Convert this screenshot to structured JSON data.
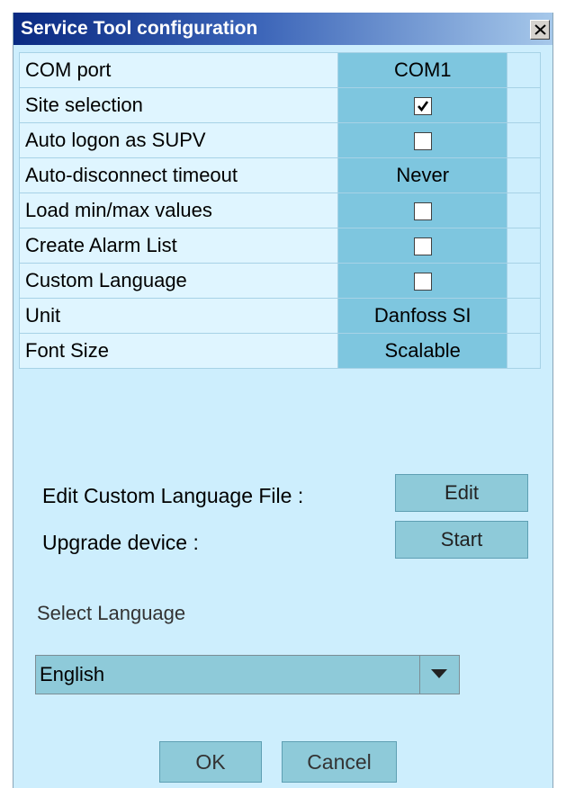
{
  "window": {
    "title": "Service Tool configuration",
    "close_label": "X"
  },
  "settings": {
    "rows": [
      {
        "label": "COM port",
        "value": "COM1",
        "type": "text"
      },
      {
        "label": "Site selection",
        "checked": true,
        "type": "checkbox"
      },
      {
        "label": "Auto logon as SUPV",
        "checked": false,
        "type": "checkbox"
      },
      {
        "label": "Auto-disconnect timeout",
        "value": "Never",
        "type": "text"
      },
      {
        "label": "Load min/max values",
        "checked": false,
        "type": "checkbox"
      },
      {
        "label": "Create Alarm List",
        "checked": false,
        "type": "checkbox"
      },
      {
        "label": "Custom Language",
        "checked": false,
        "type": "checkbox"
      },
      {
        "label": "Unit",
        "value": "Danfoss SI",
        "type": "text"
      },
      {
        "label": "Font Size",
        "value": "Scalable",
        "type": "text"
      }
    ]
  },
  "actions": {
    "edit_label": "Edit Custom Language File :",
    "edit_button": "Edit",
    "upgrade_label": "Upgrade device :",
    "upgrade_button": "Start"
  },
  "language": {
    "label": "Select Language",
    "selected": "English"
  },
  "footer": {
    "ok": "OK",
    "cancel": "Cancel"
  },
  "colors": {
    "window_bg": "#cdeefd",
    "value_cell": "#7ec6df",
    "button": "#8ecad9",
    "title_gradient_start": "#0a2a82",
    "title_gradient_end": "#a6c8ea"
  }
}
